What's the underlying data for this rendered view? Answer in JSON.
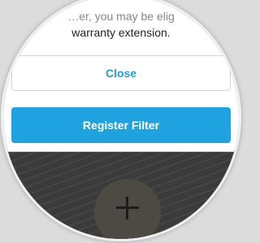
{
  "dialog": {
    "message_line1_prefix": "…er, you may be elig",
    "message_line2": "warranty extension.",
    "close_label": "Close",
    "register_label": "Register Filter"
  },
  "fab": {
    "icon": "plus-icon"
  },
  "colors": {
    "accent": "#1fa3e0",
    "link": "#2a9bd8",
    "background_dark": "#3b3b3b"
  }
}
